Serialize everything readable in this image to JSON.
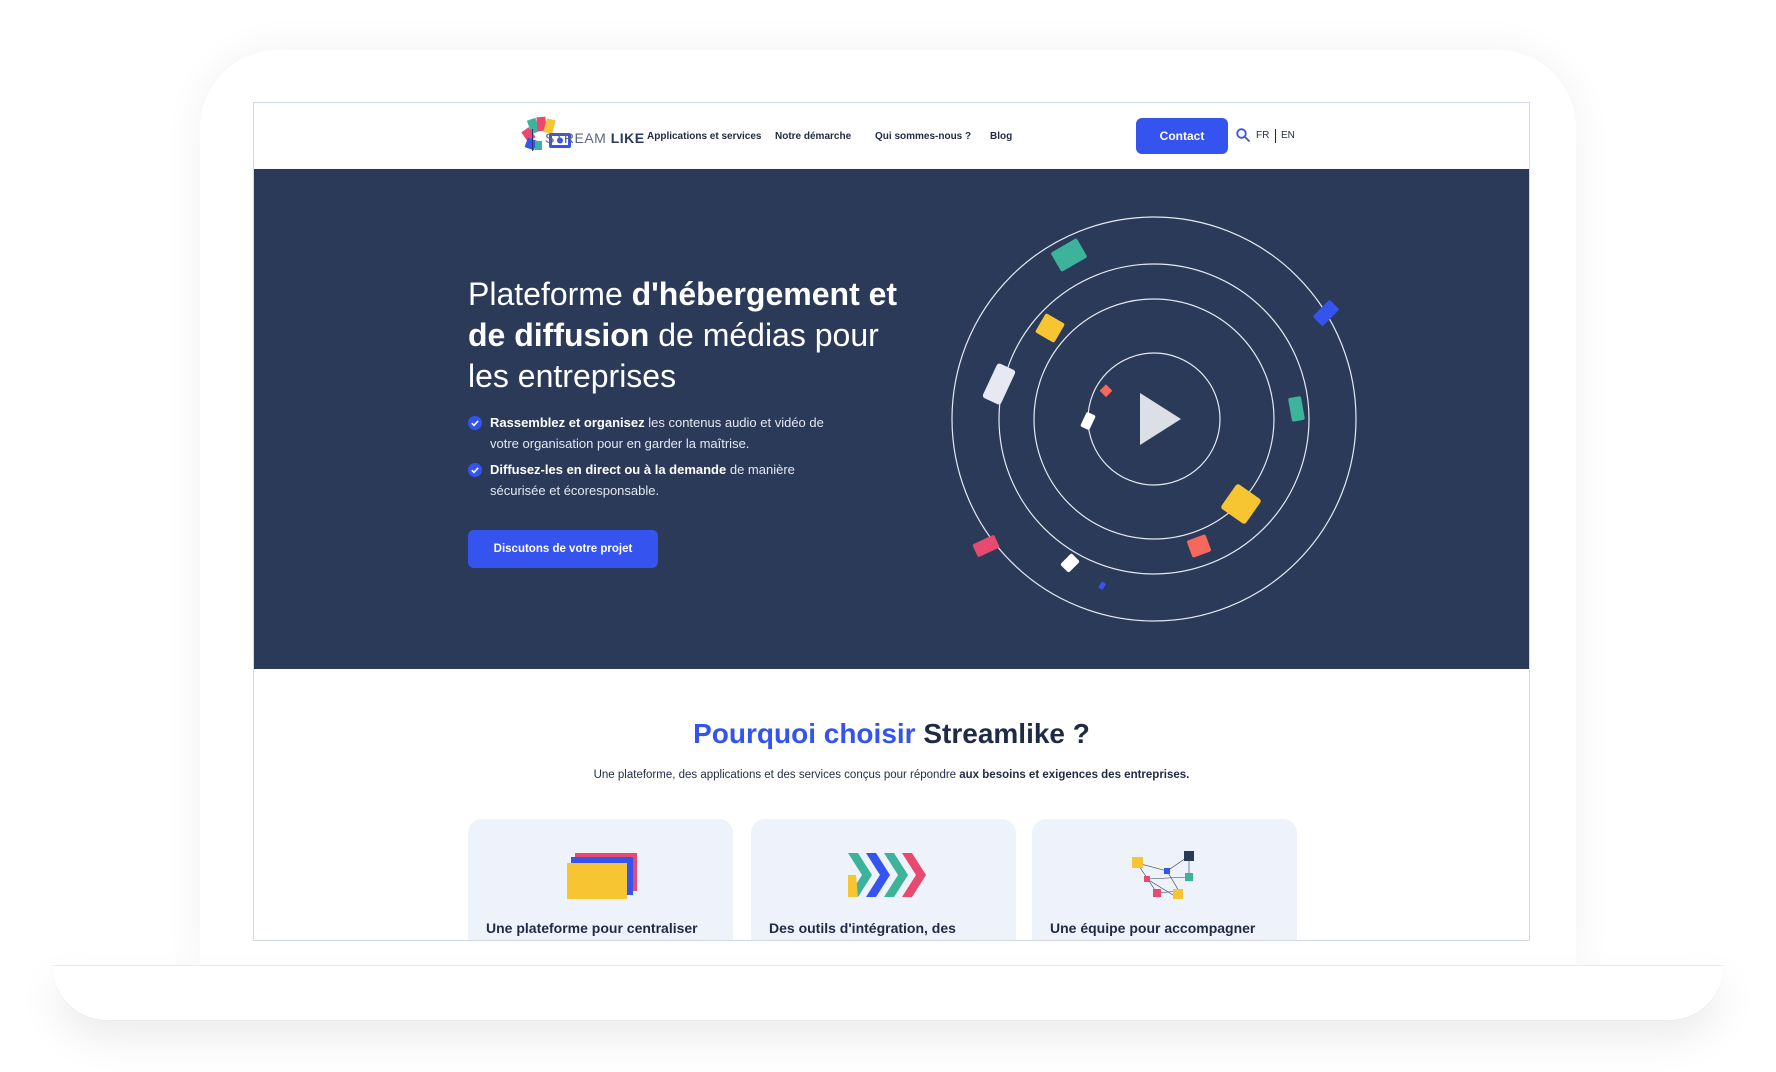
{
  "brand": {
    "name_light": "STREAM",
    "name_bold": "LIKE"
  },
  "nav": {
    "items": [
      "Applications et services",
      "Notre démarche",
      "Qui sommes-nous ?",
      "Blog"
    ],
    "contact_label": "Contact",
    "languages": [
      "FR",
      "EN"
    ]
  },
  "hero": {
    "title_part1": "Plateforme ",
    "title_bold1": "d'hébergement et de diffusion",
    "title_part2": " de médias pour les entreprises",
    "bullets": [
      {
        "bold": "Rassemblez et organisez",
        "text": " les contenus audio et vidéo de votre organisation pour en garder la maîtrise."
      },
      {
        "bold": "Diffusez-les en direct ou à la demande",
        "text": " de manière sécurisée et écoresponsable."
      }
    ],
    "cta_label": "Discutons de votre projet"
  },
  "why": {
    "title_accent": "Pourquoi choisir",
    "title_rest": " Streamlike ?",
    "subtitle": "Une plateforme, des applications et des services conçus pour répondre ",
    "subtitle_bold": "aux besoins et exigences des entreprises.",
    "cards": [
      {
        "title": "Une plateforme pour centraliser",
        "icon": "stacked-folders-icon"
      },
      {
        "title": "Des outils d'intégration, des",
        "icon": "chevrons-icon"
      },
      {
        "title": "Une équipe pour accompagner",
        "icon": "network-nodes-icon"
      }
    ]
  },
  "colors": {
    "hero_bg": "#2b3a58",
    "accent": "#3553ee",
    "text_dark": "#1f2a44",
    "card_bg": "#eef2fa"
  }
}
